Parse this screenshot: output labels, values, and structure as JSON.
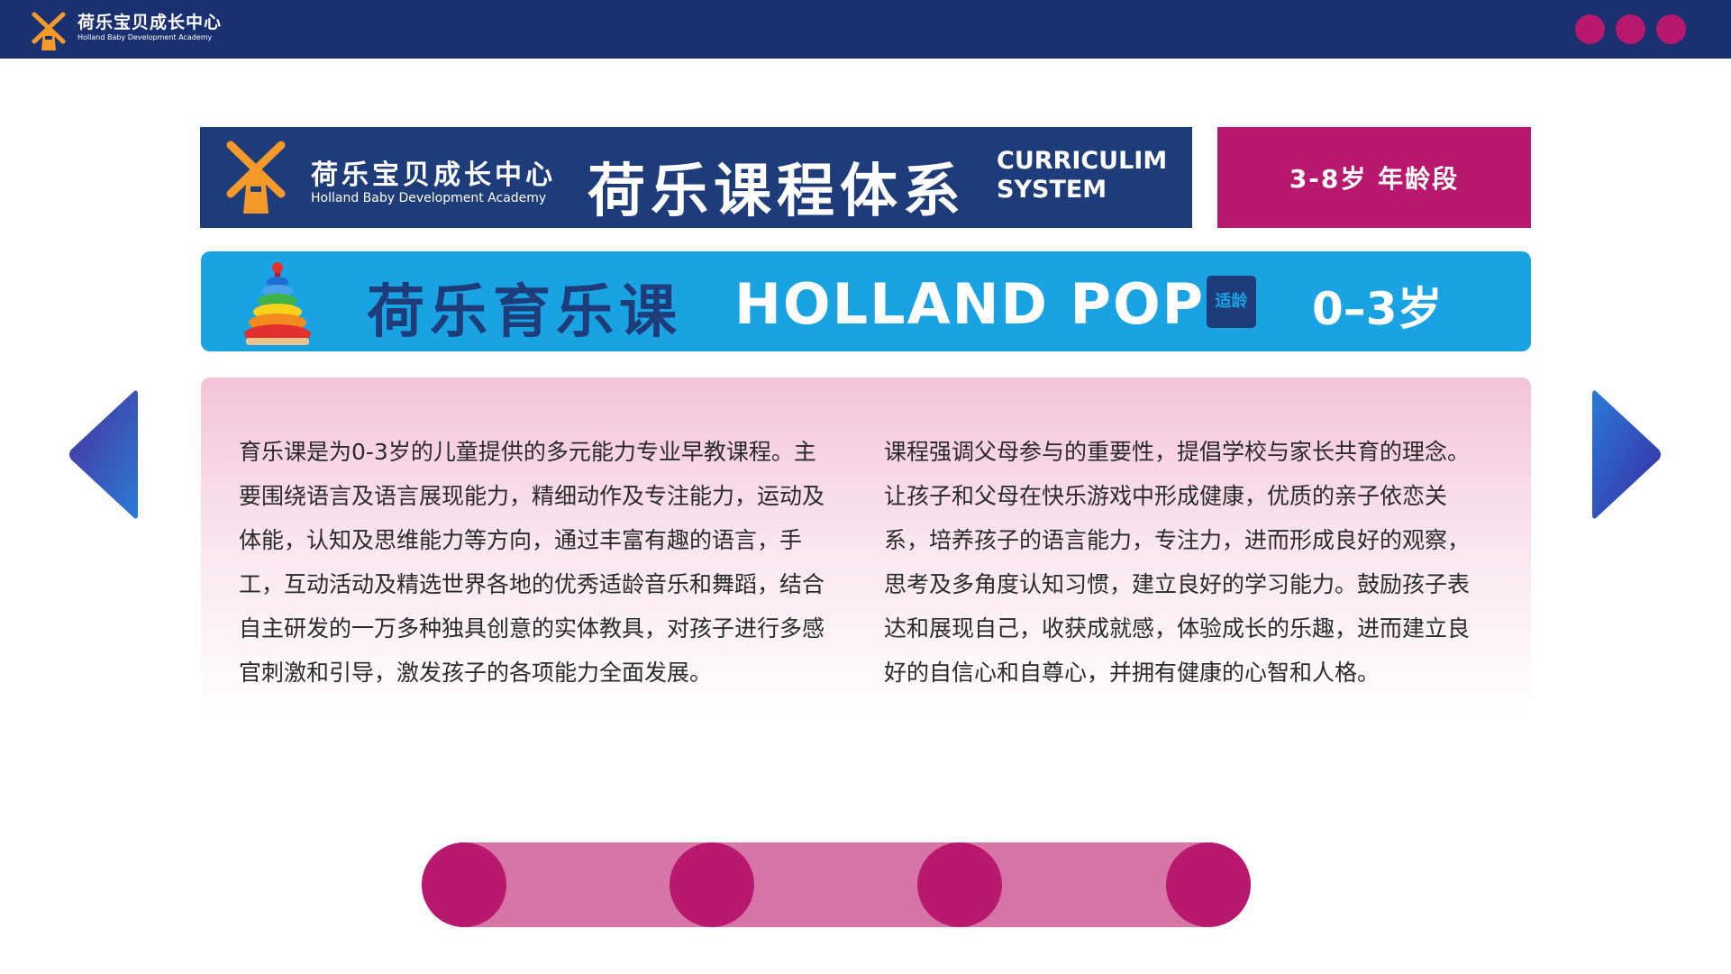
{
  "topbar": {
    "brand_zh": "荷乐宝贝成长中心",
    "brand_en": "Holland Baby Development Academy",
    "logo_icon": "windmill-icon",
    "dot_count": 3
  },
  "header": {
    "brand_zh": "荷乐宝贝成长中心",
    "brand_en": "Holland Baby Development Academy",
    "title": "荷乐课程体系",
    "title_en_line1": "CURRICULIM",
    "title_en_line2": "SYSTEM",
    "age_label": "3-8岁  年龄段"
  },
  "course": {
    "name_zh": "荷乐育乐课",
    "name_en": "HOLLAND POP",
    "fit_badge": "适龄",
    "age_range": "0–3岁",
    "icon": "stacking-rings-toy-icon"
  },
  "content": {
    "left_lines": [
      "育乐课是为0-3岁的儿童提供的多元能力专业早教课程。主",
      "要围绕语言及语言展现能力，精细动作及专注能力，运动及",
      "体能，认知及思维能力等方向，通过丰富有趣的语言，手",
      "工，互动活动及精选世界各地的优秀适龄音乐和舞蹈，结合",
      "自主研发的一万多种独具创意的实体教具，对孩子进行多感",
      "官刺激和引导，激发孩子的各项能力全面发展。"
    ],
    "right_lines": [
      "课程强调父母参与的重要性，提倡学校与家长共育的理念。",
      "让孩子和父母在快乐游戏中形成健康，优质的亲子依恋关",
      "系，培养孩子的语言能力，专注力，进而形成良好的观察，",
      "思考及多角度认知习惯，建立良好的学习能力。鼓励孩子表",
      "达和展现自己，收获成就感，体验成长的乐趣，进而建立良",
      "好的自信心和自尊心，并拥有健康的心智和人格。"
    ]
  },
  "colors": {
    "navy": "#1e3c7a",
    "magenta": "#b8196e",
    "sky": "#1aa3e2",
    "pink_track": "#d675a6"
  },
  "pager": {
    "count": 4
  }
}
